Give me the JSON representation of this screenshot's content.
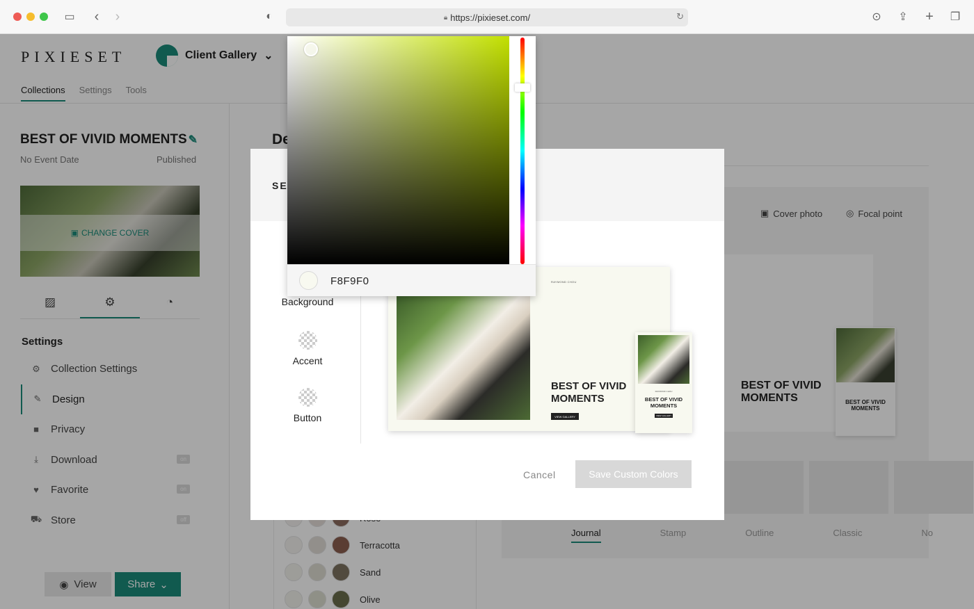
{
  "browser": {
    "url": "https://pixieset.com/"
  },
  "app": {
    "logo": "PIXIESET",
    "gallery_name": "Client Gallery",
    "nav_tabs": [
      "Collections",
      "Settings",
      "Tools"
    ]
  },
  "sidebar": {
    "collection_title": "BEST OF VIVID MOMENTS",
    "event_date": "No Event Date",
    "status": "Published",
    "change_cover": "CHANGE COVER",
    "settings_heading": "Settings",
    "menu": [
      {
        "label": "Collection Settings",
        "icon": "gear-icon"
      },
      {
        "label": "Design",
        "icon": "brush-icon"
      },
      {
        "label": "Privacy",
        "icon": "lock-icon"
      },
      {
        "label": "Download",
        "icon": "download-icon",
        "badge": "on"
      },
      {
        "label": "Favorite",
        "icon": "heart-icon",
        "badge": "on"
      },
      {
        "label": "Store",
        "icon": "cart-icon",
        "badge": "off"
      }
    ],
    "view_label": "View",
    "share_label": "Share"
  },
  "main": {
    "title_partial": "De",
    "cover_photo_label": "Cover photo",
    "focal_point_label": "Focal point",
    "card_title": "BEST OF VIVID MOMENTS",
    "layout_tabs": [
      "Journal",
      "Stamp",
      "Outline",
      "Classic",
      "No"
    ],
    "palettes": [
      "Rose",
      "Terracotta",
      "Sand",
      "Olive"
    ]
  },
  "modal": {
    "title_partial": "SE",
    "color_options": [
      "Background",
      "Accent",
      "Button"
    ],
    "preview": {
      "brand": "RAYMOND CHOU",
      "title": "BEST OF VIVID MOMENTS",
      "button": "VIEW GALLERY"
    },
    "cancel_label": "Cancel",
    "save_label": "Save Custom Colors"
  },
  "picker": {
    "hex": "F8F9F0",
    "selected_color": "#F8F9F0",
    "hue_color": "#C2E000"
  },
  "colors": {
    "accent": "#1B8A7A"
  }
}
